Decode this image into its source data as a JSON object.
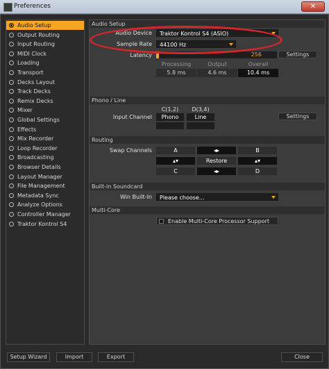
{
  "window": {
    "title": "Preferences",
    "close_label": "✕"
  },
  "sidebar": {
    "items": [
      {
        "label": "Audio Setup",
        "selected": true
      },
      {
        "label": "Output Routing"
      },
      {
        "label": "Input Routing"
      },
      {
        "label": "MIDI Clock"
      },
      {
        "label": "Loading"
      },
      {
        "label": "Transport"
      },
      {
        "label": "Decks Layout"
      },
      {
        "label": "Track Decks"
      },
      {
        "label": "Remix Decks"
      },
      {
        "label": "Mixer"
      },
      {
        "label": "Global Settings"
      },
      {
        "label": "Effects"
      },
      {
        "label": "Mix Recorder"
      },
      {
        "label": "Loop Recorder"
      },
      {
        "label": "Broadcasting"
      },
      {
        "label": "Browser Details"
      },
      {
        "label": "Layout Manager"
      },
      {
        "label": "File Management"
      },
      {
        "label": "Metadata Sync"
      },
      {
        "label": "Analyze Options"
      },
      {
        "label": "Controller Manager"
      },
      {
        "label": "Traktor Kontrol S4"
      }
    ]
  },
  "audio_setup": {
    "header": "Audio Setup",
    "device_label": "Audio Device",
    "device_value": "Traktor Kontrol S4 (ASIO)",
    "rate_label": "Sample Rate",
    "rate_value": "44100 Hz",
    "latency_label": "Latency",
    "latency_value": "256",
    "settings_label": "Settings",
    "processing_label": "Processing",
    "output_label": "Output",
    "overall_label": "Overall",
    "processing_value": "5.8 ms",
    "output_value": "4.6 ms",
    "overall_value": "10.4 ms",
    "accent": "#f5a623",
    "highlight": "#d9262b"
  },
  "phono": {
    "header": "Phono / Line",
    "ch1_label": "C(1,2)",
    "ch2_label": "D(3,4)",
    "input_channel_label": "Input Channel",
    "ch1_value": "Phono",
    "ch2_value": "Line",
    "settings_label": "Settings"
  },
  "routing": {
    "header": "Routing",
    "swap_label": "Swap Channels",
    "a": "A",
    "b": "B",
    "c": "C",
    "d": "D",
    "swap_h": "◂▸",
    "swap_v": "▴▾",
    "restore": "Restore"
  },
  "soundcard": {
    "header": "Built-in Soundcard",
    "win_label": "Win Built-In",
    "win_value": "Please choose..."
  },
  "multicore": {
    "header": "Multi-Core",
    "checkbox_label": "Enable Multi-Core Processor Support",
    "checked": false
  },
  "footer": {
    "setup_wizard": "Setup Wizard",
    "import": "Import",
    "export": "Export",
    "close": "Close"
  }
}
